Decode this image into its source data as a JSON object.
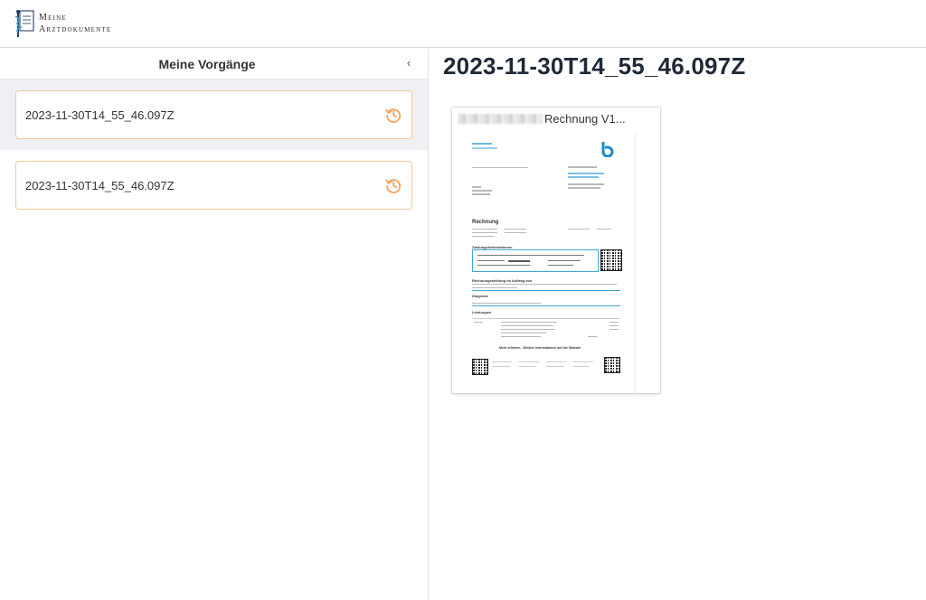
{
  "app": {
    "logo_line1": "Meine",
    "logo_line2": "Arztdokumente"
  },
  "sidebar": {
    "title": "Meine Vorgänge",
    "collapse_icon": "chevron-left-icon",
    "cases": [
      {
        "label": "2023-11-30T14_55_46.097Z",
        "icon": "history-icon",
        "active": true
      },
      {
        "label": "2023-11-30T14_55_46.097Z",
        "icon": "history-icon",
        "active": false
      }
    ]
  },
  "main": {
    "title": "2023-11-30T14_55_46.097Z",
    "documents": [
      {
        "name_visible": "Rechnung V1...",
        "thumb": {
          "heading": "Rechnung",
          "section1": "Zahlungsinformationen",
          "section2": "Rechnungsstellung im Auftrag von",
          "section3": "Diagnose",
          "section4": "Leistungen",
          "footer": "Mehr erfahren - Weitere Informationen auf der Website"
        }
      }
    ]
  },
  "colors": {
    "accent": "#f5a35c",
    "card_border": "#f2c79a",
    "active_bg": "#eef0f3",
    "brand_blue": "#1e88c9"
  }
}
